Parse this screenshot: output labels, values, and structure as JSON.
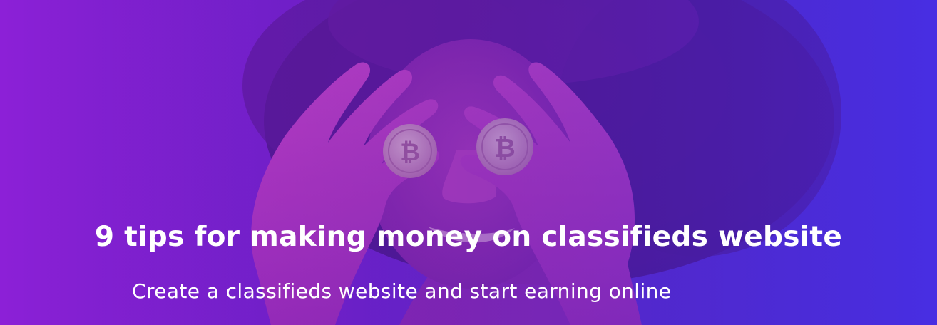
{
  "banner": {
    "headline": "9 tips for making money on classifieds website",
    "subheadline": "Create a classifieds website and start earning online",
    "colors": {
      "background_left": "#8a1fd8",
      "background_right": "#4a32e8",
      "overlay_magenta": "#c22fd1",
      "coin": "#d9a0cf",
      "text": "#ffffff"
    }
  },
  "photo": {
    "description_icon": "woman-holding-bitcoin-coins-over-eyes",
    "coin_icon": "bitcoin-coin-icon"
  }
}
